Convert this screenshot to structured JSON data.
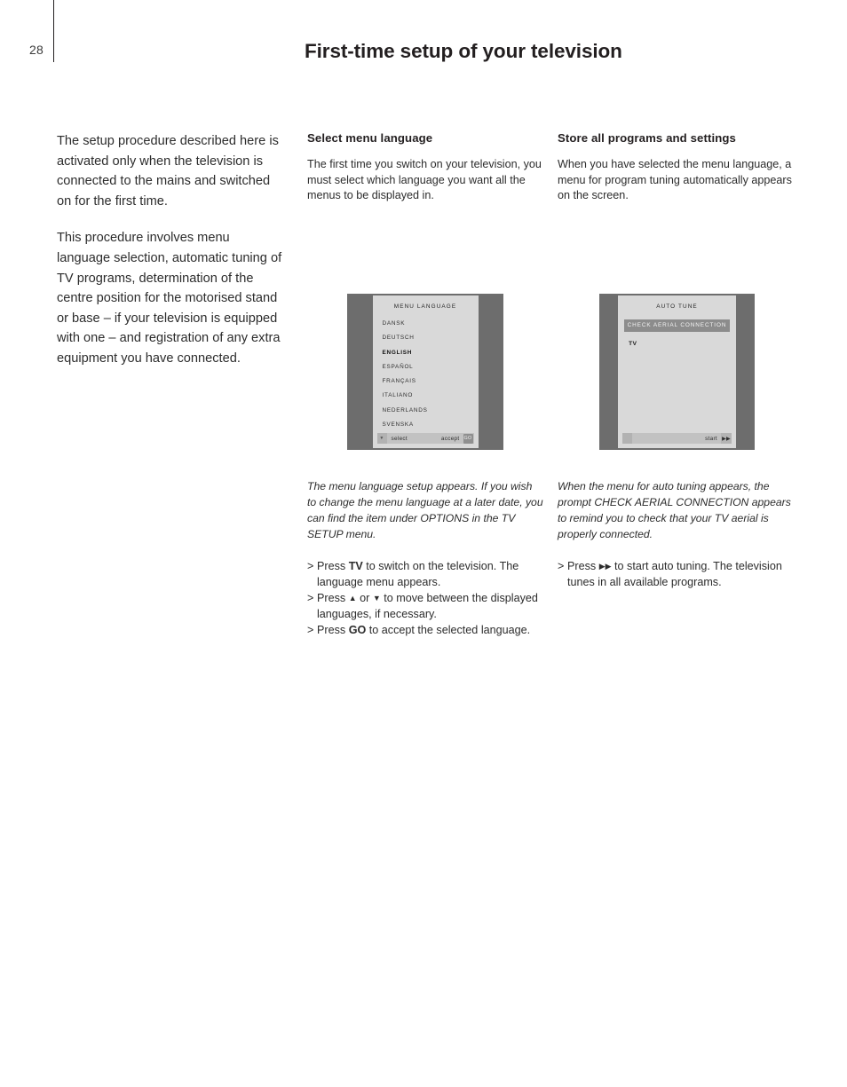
{
  "page": {
    "number": "28",
    "title": "First-time setup of your television"
  },
  "left_column": {
    "paragraph_1": "The setup procedure described here is activated only when the television is connected to the mains and switched on for the first time.",
    "paragraph_2": "This procedure involves menu language selection, automatic tuning of TV programs, determination of the centre position for the motorised stand or base – if your television is equipped with one – and registration of any extra equipment you have connected."
  },
  "middle_column": {
    "heading": "Select menu language",
    "paragraph": "The first time you switch on your television, you must select which language you want all the menus to be displayed in.",
    "caption": "The menu language setup appears. If you wish to change the menu language at a later date, you can find the item under OPTIONS in the TV SETUP menu.",
    "steps": [
      {
        "marker": ">",
        "parts": [
          {
            "text": "Press ",
            "bold": false
          },
          {
            "text": "TV",
            "bold": true
          },
          {
            "text": " to switch on the television. The language menu appears.",
            "bold": false
          }
        ]
      },
      {
        "marker": ">",
        "parts": [
          {
            "text": "Press ",
            "bold": false
          },
          {
            "text": "▲",
            "bold": false,
            "glyph": true
          },
          {
            "text": " or ",
            "bold": false
          },
          {
            "text": "▼",
            "bold": false,
            "glyph": true
          },
          {
            "text": " to move between the displayed languages, if necessary.",
            "bold": false
          }
        ]
      },
      {
        "marker": ">",
        "parts": [
          {
            "text": "Press ",
            "bold": false
          },
          {
            "text": "GO",
            "bold": true
          },
          {
            "text": " to accept the selected language.",
            "bold": false
          }
        ]
      }
    ]
  },
  "right_column": {
    "heading": "Store all programs and settings",
    "paragraph": "When you have selected the menu language, a menu for program tuning automatically appears on the screen.",
    "caption": "When the menu for auto tuning appears, the prompt CHECK AERIAL CONNECTION appears to remind you to check that your TV aerial is properly connected.",
    "steps": [
      {
        "marker": ">",
        "parts": [
          {
            "text": "Press ",
            "bold": false
          },
          {
            "text": "▶▶",
            "bold": false,
            "glyph": true
          },
          {
            "text": " to start auto tuning. The television tunes in all available programs.",
            "bold": false
          }
        ]
      }
    ]
  },
  "figures": {
    "menu_language": {
      "title": "MENU  LANGUAGE",
      "items": [
        {
          "label": "DANSK",
          "selected": false
        },
        {
          "label": "DEUTSCH",
          "selected": false
        },
        {
          "label": "ENGLISH",
          "selected": true
        },
        {
          "label": "ESPAÑOL",
          "selected": false
        },
        {
          "label": "FRANÇAIS",
          "selected": false
        },
        {
          "label": "ITALIANO",
          "selected": false
        },
        {
          "label": "NEDERLANDS",
          "selected": false
        },
        {
          "label": "SVENSKA",
          "selected": false
        }
      ],
      "bottom_bar": {
        "down_arrow": "▼",
        "select_label": "select",
        "accept_label": "accept",
        "go_icon": "GO"
      }
    },
    "auto_tune": {
      "title": "AUTO  TUNE",
      "prompt": "CHECK  AERIAL  CONNECTION",
      "source": "TV",
      "bottom_bar": {
        "start_label": "start",
        "forward_icon": "▶▶"
      }
    }
  },
  "colors": {
    "tv_frame": "#6d6d6d",
    "tv_screen": "#d9d9d9",
    "highlight_bar": "#8c8c8c",
    "text": "#231f20"
  }
}
